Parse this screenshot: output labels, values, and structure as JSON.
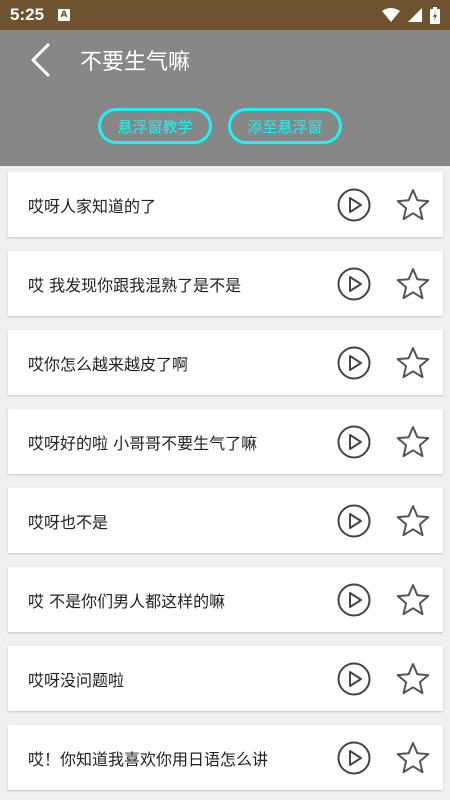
{
  "status": {
    "time": "5:25",
    "notification_icon": "A"
  },
  "header": {
    "back_icon": "back-arrow-icon",
    "title": "不要生气嘛",
    "buttons": [
      "悬浮窗教学",
      "添至悬浮窗"
    ]
  },
  "colors": {
    "accent": "#1ef3f3",
    "header_bg": "#878787",
    "status_bg": "#6e5330"
  },
  "items": [
    {
      "text": "哎呀人家知道的了"
    },
    {
      "text": "哎 我发现你跟我混熟了是不是"
    },
    {
      "text": "哎你怎么越来越皮了啊"
    },
    {
      "text": "哎呀好的啦 小哥哥不要生气了嘛"
    },
    {
      "text": "哎呀也不是"
    },
    {
      "text": "哎 不是你们男人都这样的嘛"
    },
    {
      "text": "哎呀没问题啦"
    },
    {
      "text": "哎！你知道我喜欢你用日语怎么讲"
    }
  ]
}
